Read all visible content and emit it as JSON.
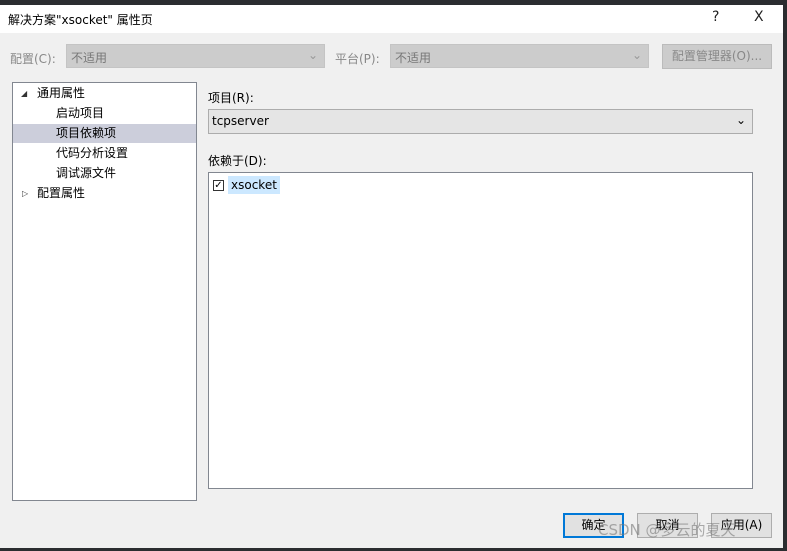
{
  "window": {
    "title": "解决方案\"xsocket\" 属性页",
    "help": "?",
    "close": "X"
  },
  "toolbar": {
    "config_label": "配置(C):",
    "config_value": "不适用",
    "platform_label": "平台(P):",
    "platform_value": "不适用",
    "manager_button": "配置管理器(O)..."
  },
  "tree": {
    "items": [
      {
        "label": "通用属性",
        "expanded": true
      },
      {
        "label": "启动项目"
      },
      {
        "label": "项目依赖项",
        "selected": true
      },
      {
        "label": "代码分析设置"
      },
      {
        "label": "调试源文件"
      },
      {
        "label": "配置属性",
        "expanded": false
      }
    ]
  },
  "main": {
    "project_label": "项目(R):",
    "project_value": "tcpserver",
    "depends_label": "依赖于(D):",
    "depends": [
      {
        "label": "xsocket",
        "checked": true
      }
    ]
  },
  "buttons": {
    "ok": "确定",
    "cancel": "取消",
    "apply": "应用(A)"
  },
  "watermark": "CSDN @多云的夏天"
}
